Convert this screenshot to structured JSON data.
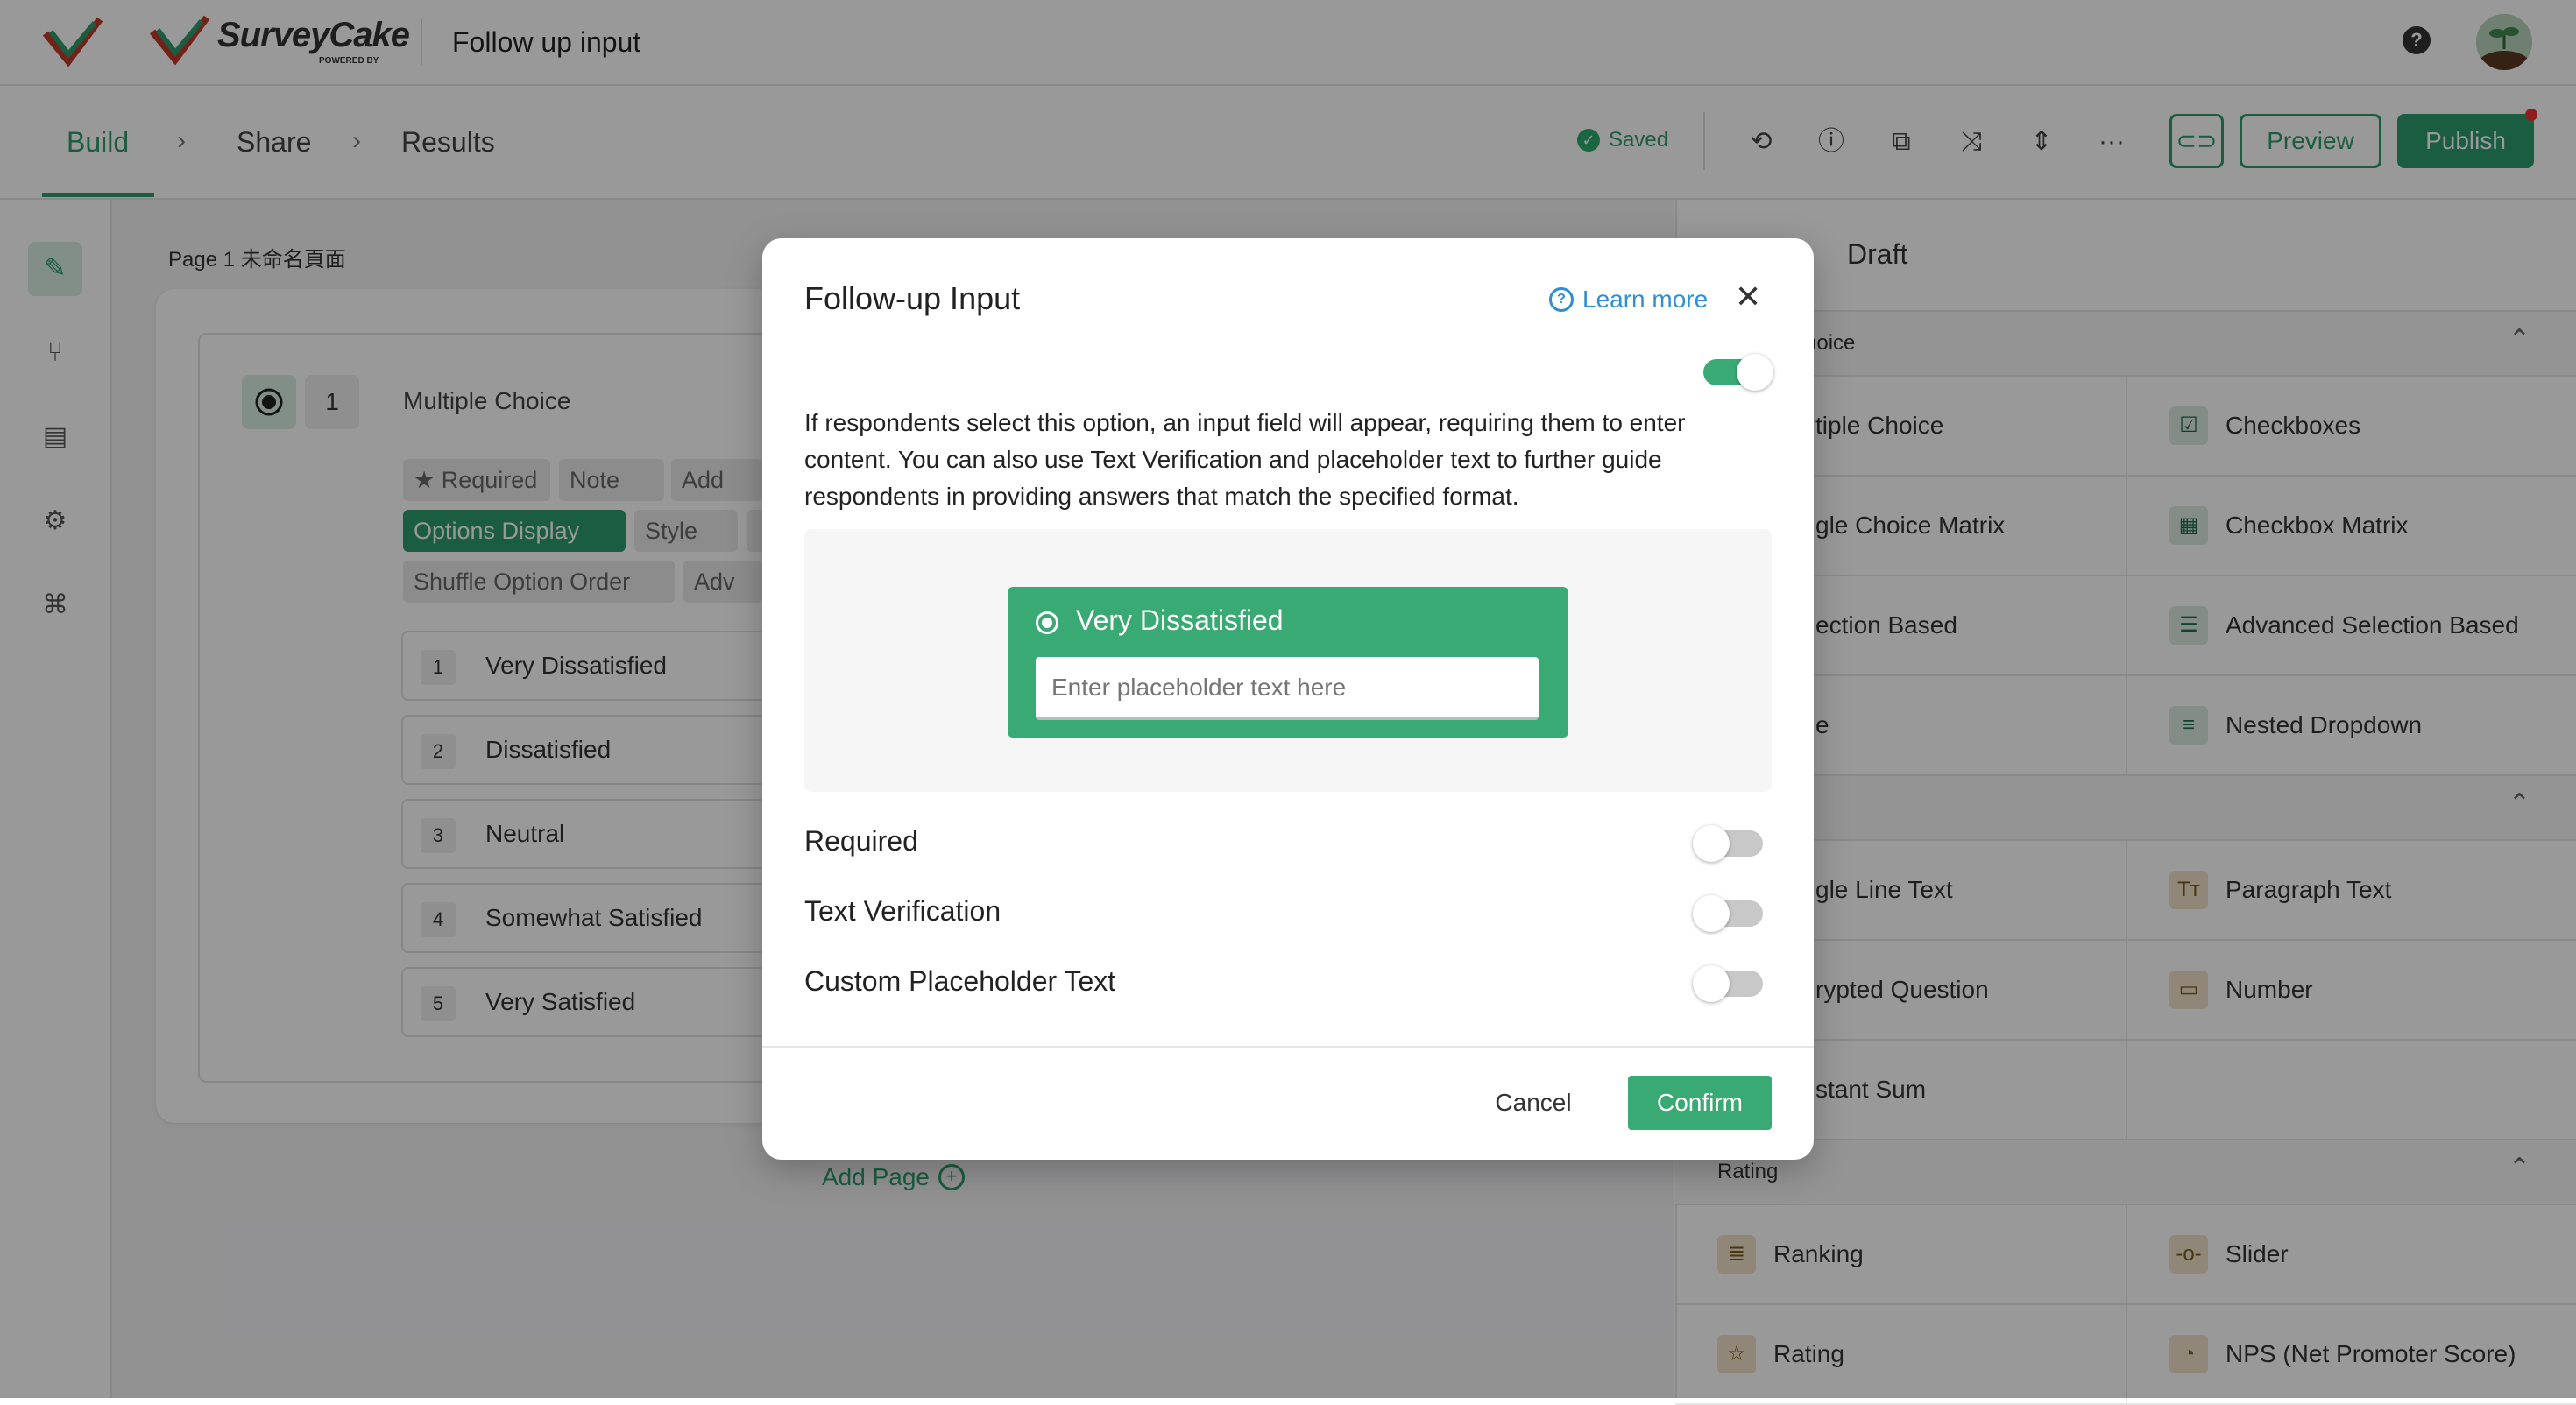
{
  "header": {
    "brand": "SurveyCake",
    "powered_by": "POWERED BY",
    "survey_title": "Follow up input",
    "help_icon": "question-circle-icon"
  },
  "nav": {
    "tabs": [
      "Build",
      "Share",
      "Results"
    ],
    "active_tab": "Build",
    "saved_label": "Saved",
    "preview_label": "Preview",
    "publish_label": "Publish"
  },
  "canvas": {
    "page_label": "Page 1  未命名頁面",
    "question_number": "1",
    "question_title": "Multiple Choice",
    "chips": {
      "required": "★ Required",
      "note": "Note",
      "add": "Add",
      "options_display": "Options Display",
      "style": "Style",
      "shuffle": "Shuffle Option Order",
      "adv": "Adv"
    },
    "options": [
      {
        "num": "1",
        "label": "Very Dissatisfied"
      },
      {
        "num": "2",
        "label": "Dissatisfied"
      },
      {
        "num": "3",
        "label": "Neutral"
      },
      {
        "num": "4",
        "label": "Somewhat Satisfied"
      },
      {
        "num": "5",
        "label": "Very Satisfied"
      }
    ],
    "add_page": "Add Page"
  },
  "panel": {
    "title": "Draft",
    "sections": {
      "choice": "hoice",
      "text": "",
      "rating": "Rating"
    },
    "items": {
      "multiple_choice": "tiple Choice",
      "checkboxes": "Checkboxes",
      "single_choice_matrix": "gle Choice Matrix",
      "checkbox_matrix": "Checkbox Matrix",
      "selection_based": "ection Based",
      "advanced_selection_based": "Advanced Selection Based",
      "dropdown": "e",
      "nested_dropdown": "Nested Dropdown",
      "single_line_text": "gle Line Text",
      "paragraph_text": "Paragraph Text",
      "encrypted_question": "rypted Question",
      "number": "Number",
      "constant_sum": "stant Sum",
      "ranking": "Ranking",
      "slider": "Slider",
      "rating": "Rating",
      "nps": "NPS (Net Promoter Score)"
    }
  },
  "modal": {
    "title": "Follow-up Input",
    "learn_more": "Learn more",
    "enabled": true,
    "description": "If respondents select this option, an input field will appear, requiring them to enter content. You can also use Text Verification and placeholder text to further guide respondents in providing answers that match the specified format.",
    "preview_option": "Very Dissatisfied",
    "preview_placeholder": "Enter placeholder text here",
    "settings": [
      {
        "label": "Required",
        "on": false
      },
      {
        "label": "Text Verification",
        "on": false
      },
      {
        "label": "Custom Placeholder Text",
        "on": false
      }
    ],
    "cancel_label": "Cancel",
    "confirm_label": "Confirm"
  },
  "colors": {
    "accent": "#2e9b6b",
    "modal_green": "#3aaa75",
    "link": "#2f8fd0"
  }
}
